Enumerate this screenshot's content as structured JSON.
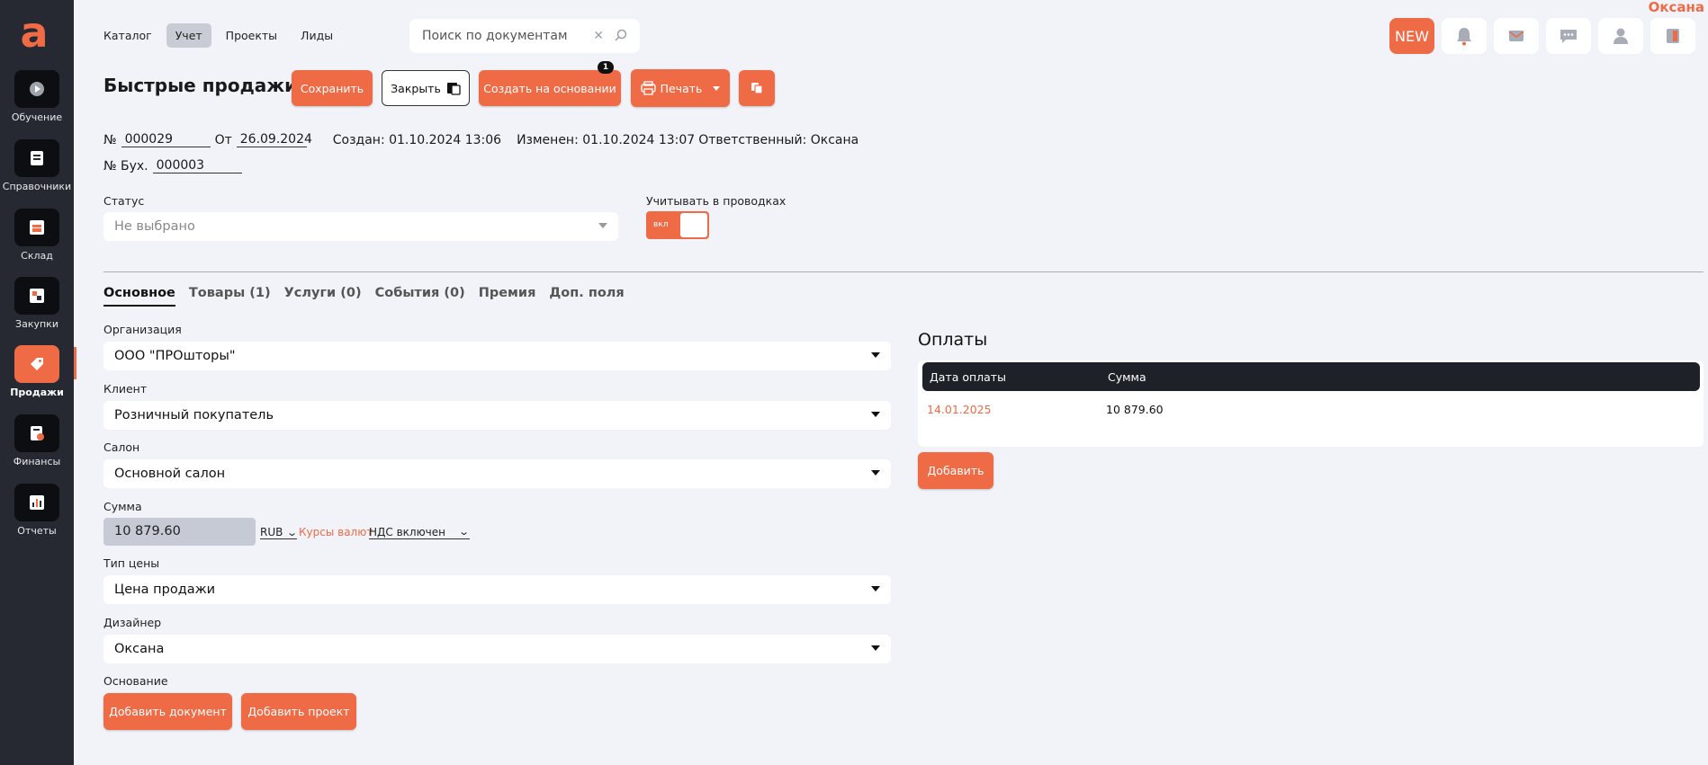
{
  "user": {
    "name": "Оксана"
  },
  "sidebar": {
    "logo": "a",
    "items": [
      {
        "label": "Обучение",
        "icon": "play-icon"
      },
      {
        "label": "Справочники",
        "icon": "book-icon"
      },
      {
        "label": "Склад",
        "icon": "warehouse-icon"
      },
      {
        "label": "Закупки",
        "icon": "purchase-icon"
      },
      {
        "label": "Продажи",
        "icon": "tag-icon",
        "active": true
      },
      {
        "label": "Финансы",
        "icon": "finance-icon"
      },
      {
        "label": "Отчеты",
        "icon": "chart-icon"
      }
    ]
  },
  "topnav": {
    "items": [
      "Каталог",
      "Учет",
      "Проекты",
      "Лиды"
    ],
    "active": "Учет"
  },
  "search": {
    "placeholder": "Поиск по документам"
  },
  "topbar": {
    "new_label": "NEW"
  },
  "page": {
    "title": "Быстрые продажи"
  },
  "toolbar": {
    "save": "Сохранить",
    "close": "Закрыть",
    "create_based": "Создать на основании",
    "create_badge": "1",
    "print": "Печать"
  },
  "doc": {
    "number_label": "№",
    "number": "000029",
    "date_label": "От",
    "date": "26.09.2024",
    "created": "Создан: 01.10.2024 13:06",
    "modified": "Изменен: 01.10.2024 13:07",
    "responsible": "Ответственный: Оксана",
    "acc_label": "№ Бух.",
    "acc_number": "000003"
  },
  "status": {
    "label": "Статус",
    "value": "Не выбрано"
  },
  "postings": {
    "label": "Учитывать в проводках",
    "toggle_label": "вкл",
    "on": true
  },
  "tabs": [
    {
      "label": "Основное",
      "active": true
    },
    {
      "label": "Товары (1)"
    },
    {
      "label": "Услуги (0)"
    },
    {
      "label": "События (0)"
    },
    {
      "label": "Премия"
    },
    {
      "label": "Доп. поля"
    }
  ],
  "form": {
    "org_label": "Организация",
    "org_value": "ООО \"ПРОшторы\"",
    "client_label": "Клиент",
    "client_value": "Розничный покупатель",
    "salon_label": "Салон",
    "salon_value": "Основной салон",
    "sum_label": "Сумма",
    "sum_value": "10 879.60",
    "currency": "RUB",
    "rates_link": "Курсы валют",
    "vat": "НДС включен",
    "price_type_label": "Тип цены",
    "price_type_value": "Цена продажи",
    "designer_label": "Дизайнер",
    "designer_value": "Оксана",
    "basis_label": "Основание",
    "add_document": "Добавить документ",
    "add_project": "Добавить проект"
  },
  "payments": {
    "title": "Оплаты",
    "col_date": "Дата оплаты",
    "col_sum": "Сумма",
    "rows": [
      {
        "date": "14.01.2025",
        "sum": "10 879.60"
      }
    ],
    "add_label": "Добавить"
  },
  "colors": {
    "accent": "#ee6b46",
    "sidebar": "#262932",
    "background": "#f1f3f8"
  }
}
